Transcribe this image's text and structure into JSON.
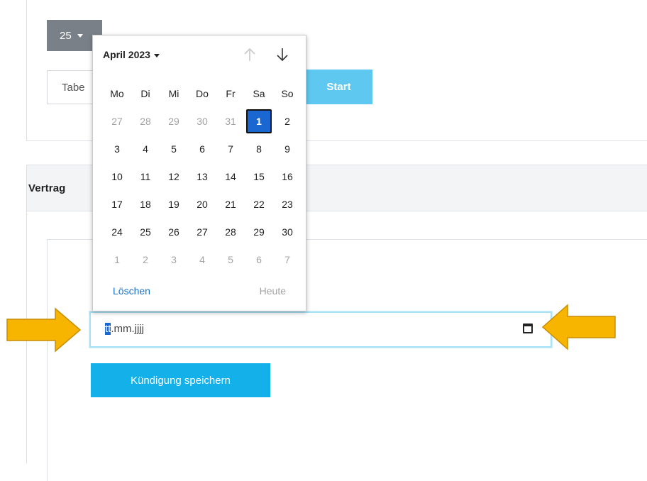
{
  "toolbar": {
    "page_size": "25",
    "table_search_value": "Tabe",
    "start_label": "Start"
  },
  "section": {
    "title": "Vertrag"
  },
  "date_input": {
    "segments": [
      "tt",
      ".mm.",
      "jjjj"
    ],
    "calendar_icon": "calendar-icon"
  },
  "save_button": {
    "label": "Kündigung speichern"
  },
  "picker": {
    "month_label": "April 2023",
    "nav_up_icon": "arrow-up-icon",
    "nav_down_icon": "arrow-down-icon",
    "weekdays": [
      "Mo",
      "Di",
      "Mi",
      "Do",
      "Fr",
      "Sa",
      "So"
    ],
    "weeks": [
      [
        {
          "d": "27",
          "o": true
        },
        {
          "d": "28",
          "o": true
        },
        {
          "d": "29",
          "o": true
        },
        {
          "d": "30",
          "o": true
        },
        {
          "d": "31",
          "o": true
        },
        {
          "d": "1",
          "o": false,
          "sel": true
        },
        {
          "d": "2",
          "o": false
        }
      ],
      [
        {
          "d": "3"
        },
        {
          "d": "4"
        },
        {
          "d": "5"
        },
        {
          "d": "6"
        },
        {
          "d": "7"
        },
        {
          "d": "8"
        },
        {
          "d": "9"
        }
      ],
      [
        {
          "d": "10"
        },
        {
          "d": "11"
        },
        {
          "d": "12"
        },
        {
          "d": "13"
        },
        {
          "d": "14"
        },
        {
          "d": "15"
        },
        {
          "d": "16"
        }
      ],
      [
        {
          "d": "17"
        },
        {
          "d": "18"
        },
        {
          "d": "19"
        },
        {
          "d": "20"
        },
        {
          "d": "21"
        },
        {
          "d": "22"
        },
        {
          "d": "23"
        }
      ],
      [
        {
          "d": "24"
        },
        {
          "d": "25"
        },
        {
          "d": "26"
        },
        {
          "d": "27"
        },
        {
          "d": "28"
        },
        {
          "d": "29"
        },
        {
          "d": "30"
        }
      ],
      [
        {
          "d": "1",
          "o": true
        },
        {
          "d": "2",
          "o": true
        },
        {
          "d": "3",
          "o": true
        },
        {
          "d": "4",
          "o": true
        },
        {
          "d": "5",
          "o": true
        },
        {
          "d": "6",
          "o": true
        },
        {
          "d": "7",
          "o": true
        }
      ]
    ],
    "clear_label": "Löschen",
    "today_label": "Heute"
  },
  "colors": {
    "accent": "#14b0ea",
    "selected_day": "#1a67d2",
    "annotation_arrow": "#f7b500"
  }
}
